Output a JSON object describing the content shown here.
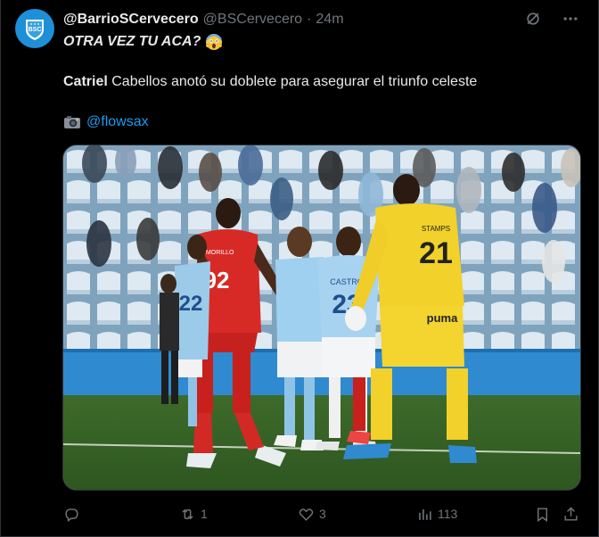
{
  "author": {
    "display_name": "@BarrioSCervecero",
    "handle": "@BSCervecero",
    "separator": "·",
    "time": "24m",
    "avatar_text": "BSC"
  },
  "tweet": {
    "line1": "OTRA VEZ TU ACA?",
    "line2_bold": "Catriel",
    "line2_rest": " Cabellos anotó su doblete para asegurar el triunfo celeste",
    "mention": "@flowsax"
  },
  "media": {
    "jersey_92": "92",
    "jersey_92_name": "J. MORILLO",
    "jersey_23": "23",
    "jersey_23_name": "CASTRO",
    "jersey_21": "21",
    "jersey_21_name": "STAMPS",
    "jersey_22": "22",
    "sponsor": "puma"
  },
  "actions": {
    "reply_count": "",
    "retweet_count": "1",
    "like_count": "3",
    "views_count": "113"
  },
  "colors": {
    "accent": "#1d9bf0",
    "muted": "#71767b",
    "avatar_bg": "#1e90d8"
  }
}
